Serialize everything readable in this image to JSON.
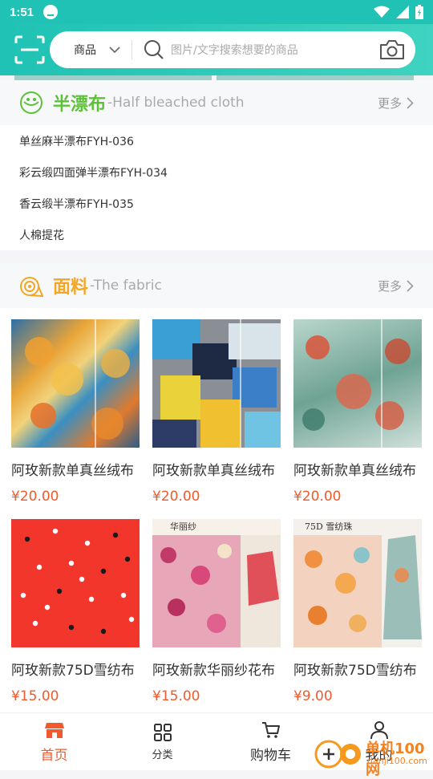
{
  "status": {
    "time": "1:51"
  },
  "search": {
    "category": "商品",
    "placeholder": "图片/文字搜索想要的商品"
  },
  "section1": {
    "title": "半漂布",
    "subtitle": "-Half bleached cloth",
    "more": "更多"
  },
  "list_items": [
    "单丝麻半漂布FYH-036",
    "彩云缎四面弹半漂布FYH-034",
    "香云缎半漂布FYH-035",
    "人棉提花"
  ],
  "section2": {
    "title": "面料",
    "subtitle": "-The fabric",
    "more": "更多"
  },
  "products": [
    {
      "name": "阿玫新款单真丝绒布",
      "price": "¥20.00"
    },
    {
      "name": "阿玫新款单真丝绒布",
      "price": "¥20.00"
    },
    {
      "name": "阿玫新款单真丝绒布",
      "price": "¥20.00"
    },
    {
      "name": "阿玫新款75D雪纺布",
      "price": "¥15.00"
    },
    {
      "name": "阿玫新款华丽纱花布",
      "price": "¥15.00"
    },
    {
      "name": "阿玫新款75D雪纺布",
      "price": "¥9.00"
    }
  ],
  "product_image_text": {
    "p5": "华丽纱",
    "p6": "75D 雪纺珠"
  },
  "tabs": [
    {
      "label": "首页",
      "icon": "shop-icon",
      "active": true
    },
    {
      "label": "分类",
      "icon": "grid-icon",
      "active": false
    },
    {
      "label": "购物车",
      "icon": "cart-icon",
      "active": false
    },
    {
      "label": "我的",
      "icon": "user-icon",
      "active": false
    }
  ],
  "watermark": {
    "text": "单机100网",
    "url": "danji100.com"
  },
  "colors": {
    "accent": "#1fc2b4",
    "price": "#f05a2c",
    "section1_title": "#5bc236",
    "section2_title": "#f5a623"
  }
}
